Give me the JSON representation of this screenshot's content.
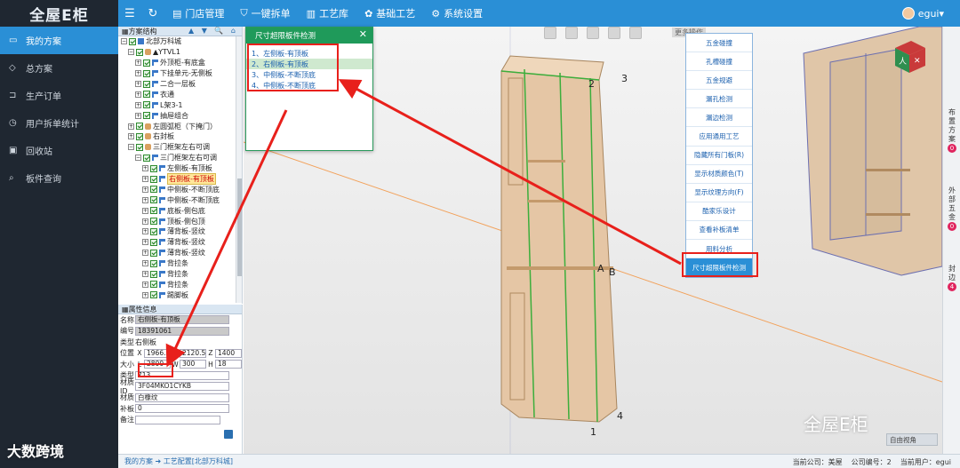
{
  "app": {
    "logo": "全屋E柜",
    "nav": [
      {
        "icon": "menu-icon",
        "label": ""
      },
      {
        "icon": "refresh-icon",
        "label": ""
      },
      {
        "icon": "document-icon",
        "label": "门店管理"
      },
      {
        "icon": "shield-icon",
        "label": "一键拆单"
      },
      {
        "icon": "bars-icon",
        "label": "工艺库"
      },
      {
        "icon": "palette-icon",
        "label": "基础工艺"
      },
      {
        "icon": "gear-icon",
        "label": "系统设置"
      }
    ],
    "user": "egui"
  },
  "sidebar": {
    "items": [
      {
        "label": "我的方案",
        "active": true
      },
      {
        "label": "总方案",
        "active": false
      },
      {
        "label": "生产订单",
        "active": false
      },
      {
        "label": "用户拆单统计",
        "active": false
      },
      {
        "label": "回收站",
        "active": false
      },
      {
        "label": "板件查询",
        "active": false
      }
    ]
  },
  "tree": {
    "title": "方案结构",
    "tools": "▲ ▼ 🔍 ⌂",
    "rows": [
      {
        "indent": 0,
        "label": "北部万科城",
        "icon": "blue",
        "pm": "⊟"
      },
      {
        "indent": 1,
        "label": "▲YTVL1",
        "icon": "wood",
        "pm": "⊟"
      },
      {
        "indent": 2,
        "label": "外顶柜-有底盒",
        "icon": "flag",
        "pm": "⊞"
      },
      {
        "indent": 2,
        "label": "下挂单元-无侧板",
        "icon": "flag",
        "pm": "⊞"
      },
      {
        "indent": 2,
        "label": "二合一层板",
        "icon": "flag",
        "pm": "⊞"
      },
      {
        "indent": 2,
        "label": "衣通",
        "icon": "flag",
        "pm": "⊞"
      },
      {
        "indent": 2,
        "label": "L架3-1",
        "icon": "flag",
        "pm": "⊞"
      },
      {
        "indent": 2,
        "label": "抽屉组合",
        "icon": "flag",
        "pm": "⊞"
      },
      {
        "indent": 1,
        "label": "左圆弧柜（下掩门）",
        "icon": "wood",
        "pm": "⊞"
      },
      {
        "indent": 1,
        "label": "右封板",
        "icon": "wood",
        "pm": "⊞"
      },
      {
        "indent": 1,
        "label": "三门框架左右可调",
        "icon": "wood",
        "pm": "⊟"
      },
      {
        "indent": 2,
        "label": "三门框架左右可调",
        "icon": "flag",
        "pm": "⊟"
      },
      {
        "indent": 3,
        "label": "左侧板-有顶板",
        "icon": "flag",
        "pm": "⊞"
      },
      {
        "indent": 3,
        "label": "右侧板-有顶板",
        "icon": "flag",
        "pm": "⊞",
        "selected": true
      },
      {
        "indent": 3,
        "label": "中侧板-不断顶底",
        "icon": "flag",
        "pm": "⊞"
      },
      {
        "indent": 3,
        "label": "中侧板-不断顶底",
        "icon": "flag",
        "pm": "⊞"
      },
      {
        "indent": 3,
        "label": "底板-侧包底",
        "icon": "flag",
        "pm": "⊞"
      },
      {
        "indent": 3,
        "label": "顶板-侧包顶",
        "icon": "flag",
        "pm": "⊞"
      },
      {
        "indent": 3,
        "label": "薄背板-竖纹",
        "icon": "flag",
        "pm": "⊞"
      },
      {
        "indent": 3,
        "label": "薄背板-竖纹",
        "icon": "flag",
        "pm": "⊞"
      },
      {
        "indent": 3,
        "label": "薄背板-竖纹",
        "icon": "flag",
        "pm": "⊞"
      },
      {
        "indent": 3,
        "label": "背拉条",
        "icon": "flag",
        "pm": "⊞"
      },
      {
        "indent": 3,
        "label": "背拉条",
        "icon": "flag",
        "pm": "⊞"
      },
      {
        "indent": 3,
        "label": "背拉条",
        "icon": "flag",
        "pm": "⊞"
      },
      {
        "indent": 3,
        "label": "踢脚板",
        "icon": "flag",
        "pm": "⊞"
      }
    ]
  },
  "props": {
    "title": "属性信息",
    "name_label": "名称",
    "name": "右侧板-有顶板",
    "code_label": "编号",
    "code": "18391061",
    "type_label": "类型",
    "type": "右侧板",
    "pos_label": "位置",
    "pos_x": "1966.5",
    "pos_y": "2120.5",
    "pos_z": "1400",
    "size_label": "大小",
    "size_l": "2800",
    "size_w": "300",
    "size_h": "18",
    "kind_label": "类型",
    "kind": "713",
    "material_id_label": "材质ID",
    "material_id": "3F04MKO1CYKB",
    "material_label": "材质",
    "material": "白橡纹",
    "patch_label": "补板",
    "patch": "0",
    "remark_label": "备注",
    "remark": ""
  },
  "popup": {
    "title": "尺寸超限板件检测",
    "items": [
      "1、左侧板-有顶板",
      "2、右侧板-有顶板",
      "3、中侧板-不断顶底",
      "4、中侧板-不断顶底"
    ]
  },
  "toolbar": {
    "more": "更多操作"
  },
  "context_menu": {
    "items": [
      "五金碰撞",
      "孔槽碰撞",
      "五金规避",
      "漏孔检测",
      "漏边检测",
      "应用通用工艺",
      "隐藏所有门板(R)",
      "显示材质颜色(T)",
      "显示纹理方向(F)",
      "酷家乐设计",
      "查看补板清单",
      "用料分析",
      "尺寸超限板件检测"
    ],
    "active_index": 12
  },
  "right_tabs": [
    {
      "label": "布 置 方 案",
      "count": "0"
    },
    {
      "label": "外 部 五 金",
      "count": "0"
    },
    {
      "label": "封 边",
      "count": "4"
    }
  ],
  "viewport": {
    "point_labels": [
      "2",
      "3",
      "A",
      "B",
      "1",
      "4"
    ],
    "view_select": "自由视角"
  },
  "watermarks": {
    "right": "全屋E柜",
    "left": "大数跨境"
  },
  "statusbar": {
    "breadcrumb": "我的方案 ➜ 工艺配置[北部万科城]",
    "user_label": "当前公司：美屋",
    "company_code": "公司编号：2",
    "current_user": "当前用户：egui"
  }
}
